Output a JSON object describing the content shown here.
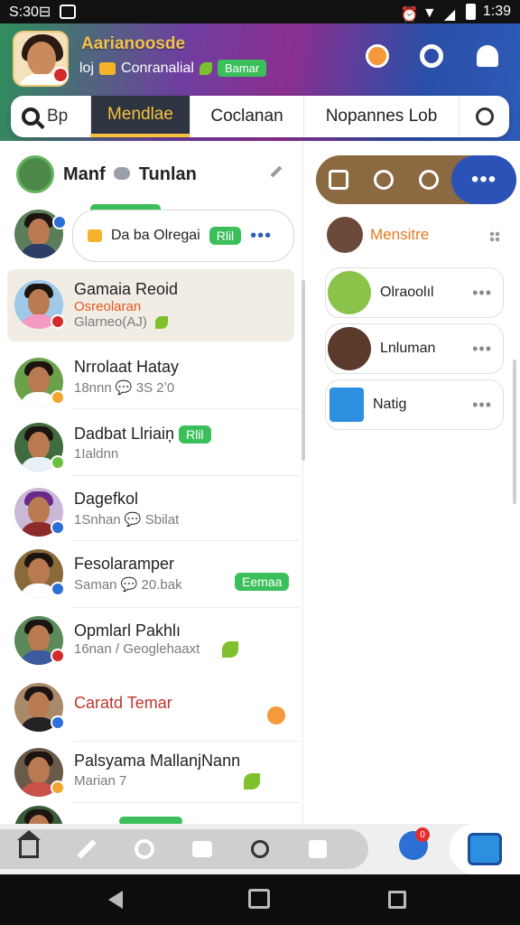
{
  "status_bar": {
    "left_text": "S:30⊟",
    "time": "1:39"
  },
  "header": {
    "user_name": "Aarianoosde",
    "sub_prefix": "loj",
    "sub_text": "Conranalial",
    "chip_label": "Bamar"
  },
  "tabs": [
    {
      "label": "Bp"
    },
    {
      "label": "Mendlae"
    },
    {
      "label": "Coclanan"
    },
    {
      "label": "Nopannes Lob"
    }
  ],
  "group": {
    "title_a": "Manf",
    "title_b": "Tunlan"
  },
  "pinned_message": {
    "text": "Da ba Olregai",
    "chip": "Rlil",
    "more": "•••"
  },
  "chats": [
    {
      "name": "Gamaia Reoid",
      "sub": "Osreolaran",
      "sub2": "Glarneo(AJ)"
    },
    {
      "name": "Nrrolaat Hatay",
      "sub": "18nnn",
      "sub_b": "3S 2ʼ0"
    },
    {
      "name": "Dadbat Llriaiņ",
      "chip": "Rlil",
      "sub": "1Ialdnn"
    },
    {
      "name": "Dagefkol",
      "sub": "1Snhan",
      "sub_b": "Sbilat"
    },
    {
      "name": "Fesolaramper",
      "sub": "Saman",
      "sub_b": "20.bak",
      "chip": "Eemaa"
    },
    {
      "name": "Opmlarl Pakhlı",
      "sub": "16nan",
      "sub_b": "Geoglehaaxt"
    },
    {
      "name": "Caratd Temar"
    },
    {
      "name": "Palsyama MallanjNann",
      "sub": "Marian",
      "sub_b": "7"
    }
  ],
  "right_panel": {
    "head_title": "Mensitre",
    "cards": [
      {
        "name": "Olraoolıl",
        "more": "•••"
      },
      {
        "name": "Lnluman",
        "more": "•••"
      },
      {
        "name": "Natig",
        "more": "•••"
      }
    ],
    "seg_more": "•••"
  },
  "bottom_nav": {
    "notif_count": "0"
  },
  "colors": {
    "accent_green": "#3bbf5a",
    "accent_blue": "#2c52b8",
    "tab_active": "#f6c23e"
  }
}
